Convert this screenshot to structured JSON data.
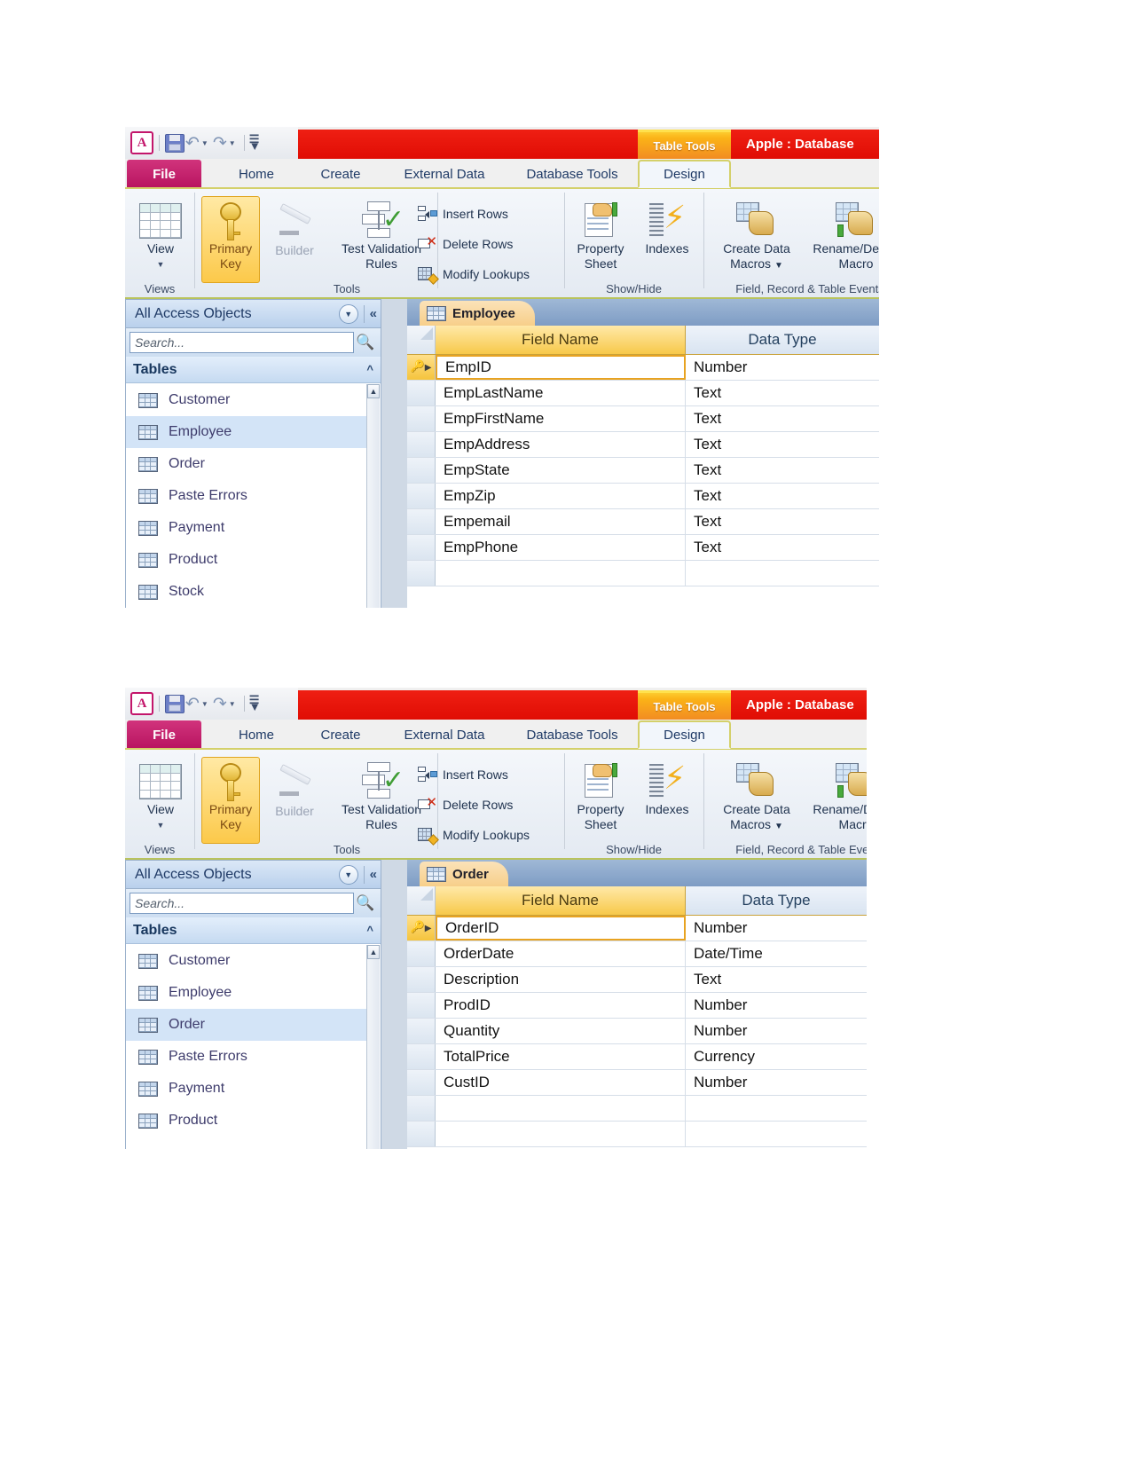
{
  "app": {
    "logo_letter": "A",
    "quick_access": [
      {
        "name": "save-icon",
        "label": "Save"
      },
      {
        "name": "undo-icon",
        "label": "Undo"
      },
      {
        "name": "redo-icon",
        "label": "Redo"
      },
      {
        "name": "customize-qat-icon",
        "label": "Customize Quick Access Toolbar"
      }
    ],
    "contextual_tab_label": "Table Tools",
    "window_title": "Apple : Database",
    "window_title_clipped": "Apple : Database"
  },
  "ribbon": {
    "file_tab": "File",
    "tabs": [
      {
        "label": "Home",
        "active": false
      },
      {
        "label": "Create",
        "active": false
      },
      {
        "label": "External Data",
        "active": false
      },
      {
        "label": "Database Tools",
        "active": false
      },
      {
        "label": "Design",
        "active": true
      }
    ],
    "groups": [
      {
        "label": "Views"
      },
      {
        "label": "Tools"
      },
      {
        "label": "Show/Hide"
      },
      {
        "label": "Field, Record & Table Events"
      }
    ],
    "buttons": {
      "view": "View",
      "primary_key_line1": "Primary",
      "primary_key_line2": "Key",
      "builder": "Builder",
      "test_validation_line1": "Test Validation",
      "test_validation_line2": "Rules",
      "insert_rows": "Insert Rows",
      "delete_rows": "Delete Rows",
      "modify_lookups": "Modify Lookups",
      "property_sheet_line1": "Property",
      "property_sheet_line2": "Sheet",
      "indexes": "Indexes",
      "create_data_macros_line1": "Create Data",
      "create_data_macros_line2": "Macros",
      "rename_delete_macro_line1": "Rename/Delete",
      "rename_delete_macro_line2": "Macro"
    }
  },
  "nav_pane": {
    "title": "All Access Objects",
    "search_placeholder": "Search...",
    "group_title": "Tables"
  },
  "screens": [
    {
      "id": "employee",
      "nav_items": [
        {
          "label": "Customer",
          "selected": false
        },
        {
          "label": "Employee",
          "selected": true
        },
        {
          "label": "Order",
          "selected": false
        },
        {
          "label": "Paste Errors",
          "selected": false
        },
        {
          "label": "Payment",
          "selected": false
        },
        {
          "label": "Product",
          "selected": false
        },
        {
          "label": "Stock",
          "selected": false
        }
      ],
      "doc_tab": "Employee",
      "grid": {
        "col_field_name": "Field Name",
        "col_data_type": "Data Type",
        "rows": [
          {
            "field": "EmpID",
            "type": "Number",
            "primary_key": true
          },
          {
            "field": "EmpLastName",
            "type": "Text",
            "primary_key": false
          },
          {
            "field": "EmpFirstName",
            "type": "Text",
            "primary_key": false
          },
          {
            "field": "EmpAddress",
            "type": "Text",
            "primary_key": false
          },
          {
            "field": "EmpState",
            "type": "Text",
            "primary_key": false
          },
          {
            "field": "EmpZip",
            "type": "Text",
            "primary_key": false
          },
          {
            "field": "Empemail",
            "type": "Text",
            "primary_key": false
          },
          {
            "field": "EmpPhone",
            "type": "Text",
            "primary_key": false
          },
          {
            "field": "",
            "type": "",
            "primary_key": false
          }
        ]
      }
    },
    {
      "id": "order",
      "nav_items": [
        {
          "label": "Customer",
          "selected": false
        },
        {
          "label": "Employee",
          "selected": false
        },
        {
          "label": "Order",
          "selected": true
        },
        {
          "label": "Paste Errors",
          "selected": false
        },
        {
          "label": "Payment",
          "selected": false
        },
        {
          "label": "Product",
          "selected": false
        }
      ],
      "doc_tab": "Order",
      "grid": {
        "col_field_name": "Field Name",
        "col_data_type": "Data Type",
        "rows": [
          {
            "field": "OrderID",
            "type": "Number",
            "primary_key": true
          },
          {
            "field": "OrderDate",
            "type": "Date/Time",
            "primary_key": false
          },
          {
            "field": "Description",
            "type": "Text",
            "primary_key": false
          },
          {
            "field": "ProdID",
            "type": "Number",
            "primary_key": false
          },
          {
            "field": "Quantity",
            "type": "Number",
            "primary_key": false
          },
          {
            "field": "TotalPrice",
            "type": "Currency",
            "primary_key": false
          },
          {
            "field": "CustID",
            "type": "Number",
            "primary_key": false
          },
          {
            "field": "",
            "type": "",
            "primary_key": false
          },
          {
            "field": "",
            "type": "",
            "primary_key": false
          }
        ]
      }
    }
  ],
  "colors": {
    "title_red": "#e4100a",
    "contextual_orange": "#f39020",
    "file_magenta": "#c21c6d",
    "primary_key_gold": "#f7c849",
    "header_gold": "#f7c94a",
    "doc_tab_blue": "#8aa6ca"
  }
}
